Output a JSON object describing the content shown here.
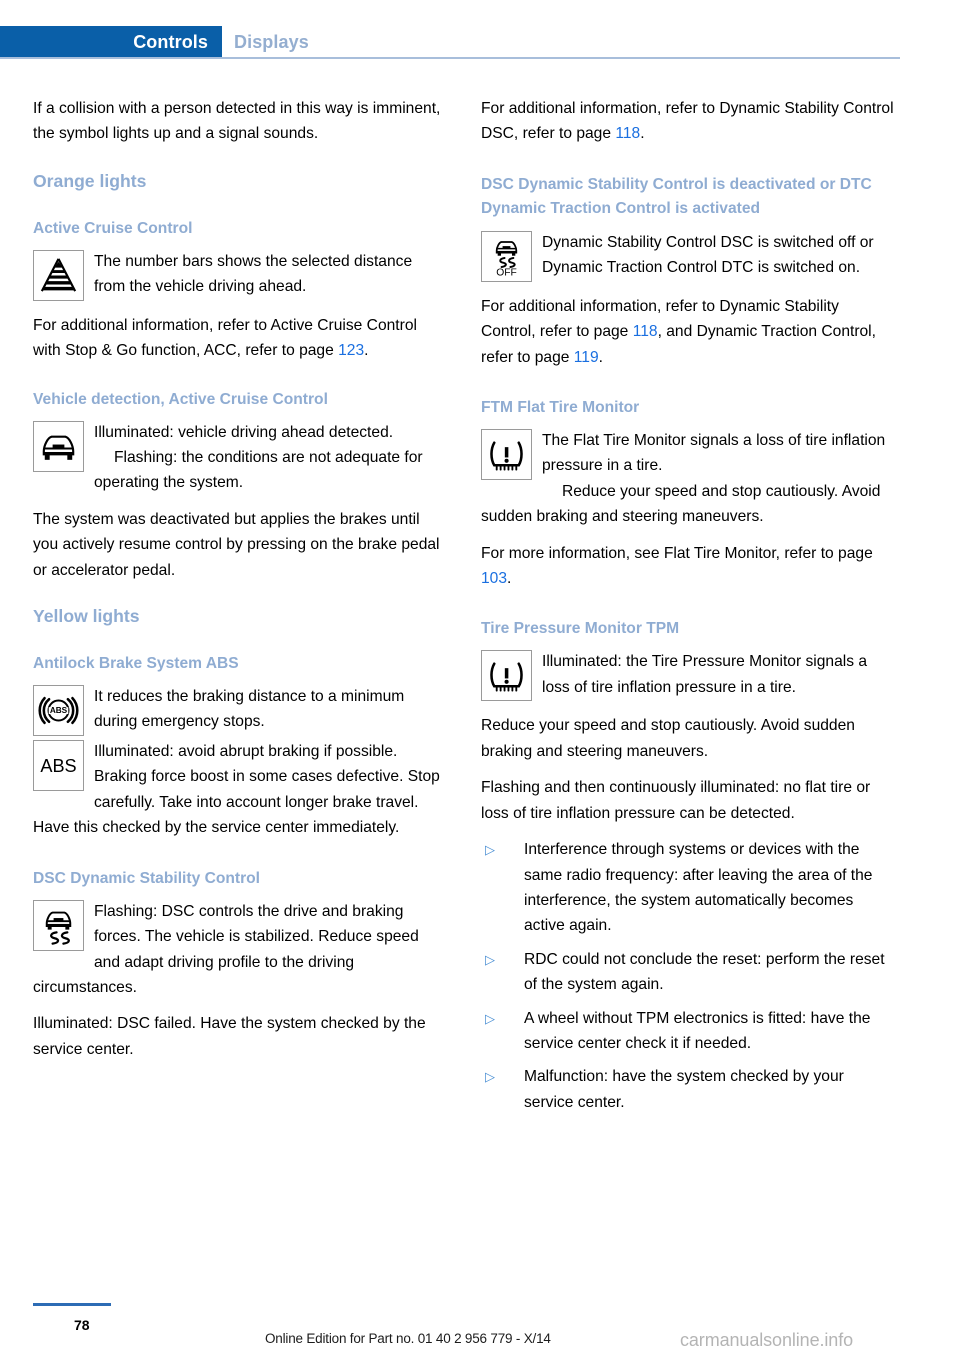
{
  "header": {
    "active_tab": "Controls",
    "inactive_tab": "Displays",
    "active_tab_color": "#0a5fa8",
    "inactive_tab_color": "#94aed0"
  },
  "colors": {
    "heading_blue": "#8facd2",
    "page_ref_blue": "#1a6fe0",
    "bullet_blue": "#4a8fd4"
  },
  "left_column": {
    "intro_paragraph": "If a collision with a person detected in this way is imminent, the symbol lights up and a signal sounds.",
    "section_orange": "Orange lights",
    "acc": {
      "heading": "Active Cruise Control",
      "icon_name": "distance-bars-icon",
      "icon_text": "The number bars shows the selected distance from the vehicle driving ahead.",
      "para_prefix": "For additional information, refer to Active Cruise Control with Stop & Go function, ACC, refer to page ",
      "page_ref": "123",
      "para_suffix": "."
    },
    "vehicle_detection": {
      "heading": "Vehicle detection, Active Cruise Control",
      "icon_name": "car-front-icon",
      "icon_text": "Illuminated: vehicle driving ahead detected.",
      "flashing_text": "Flashing: the conditions are not adequate for operating the system.",
      "system_text": "The system was deactivated but applies the brakes until you actively resume control by pressing on the brake pedal or accelerator pedal."
    },
    "section_yellow": "Yellow lights",
    "abs": {
      "heading": "Antilock Brake System ABS",
      "icon1_name": "abs-ring-icon",
      "icon1_text": "It reduces the braking distance to a minimum during emergency stops.",
      "icon2_name": "abs-text-icon",
      "icon2_label": "ABS",
      "icon2_text": "Illuminated: avoid abrupt braking if possible. Braking force boost in some cases defective. Stop carefully. Take into account longer brake travel. Have this checked by the service center immediately."
    },
    "dsc": {
      "heading": "DSC Dynamic Stability Control",
      "icon_name": "dsc-skid-icon",
      "icon_text": "Flashing: DSC controls the drive and braking forces. The vehicle is stabilized. Reduce speed and adapt driving profile to the driving circumstances.",
      "illuminated_text": "Illuminated: DSC failed. Have the system checked by the service center."
    }
  },
  "right_column": {
    "dsc_info": {
      "para_prefix": "For additional information, refer to Dynamic Stability Control DSC, refer to page ",
      "page_ref": "118",
      "para_suffix": "."
    },
    "dsc_off": {
      "heading": "DSC Dynamic Stability Control is deactivated or DTC Dynamic Traction Control is activated",
      "icon_name": "dsc-off-icon",
      "icon_label": "OFF",
      "icon_text": "Dynamic Stability Control DSC is switched off or Dynamic Traction Control DTC is switched on.",
      "para_part1": "For additional information, refer to Dynamic Stability Control, refer to page ",
      "page_ref_1": "118",
      "para_part2": ", and Dynamic Traction Control, refer to page ",
      "page_ref_2": "119",
      "para_part3": "."
    },
    "ftm": {
      "heading": "FTM Flat Tire Monitor",
      "icon_name": "tire-pressure-warning-icon",
      "icon_text": "The Flat Tire Monitor signals a loss of tire inflation pressure in a tire.",
      "reduce_text": "Reduce your speed and stop cautiously. Avoid sudden braking and steering maneuvers.",
      "more_info_prefix": "For more information, see Flat Tire Monitor, refer to page ",
      "page_ref": "103",
      "more_info_suffix": "."
    },
    "tpm": {
      "heading": "Tire Pressure Monitor TPM",
      "icon_name": "tire-pressure-warning-icon",
      "icon_text": "Illuminated: the Tire Pressure Monitor signals a loss of tire inflation pressure in a tire.",
      "reduce_text": "Reduce your speed and stop cautiously. Avoid sudden braking and steering maneuvers.",
      "flashing_text": "Flashing and then continuously illuminated: no flat tire or loss of tire inflation pressure can be detected.",
      "bullets": [
        "Interference through systems or devices with the same radio frequency: after leaving the area of the interference, the system automatically becomes active again.",
        "RDC could not conclude the reset: perform the reset of the system again.",
        "A wheel without TPM electronics is fitted: have the service center check it if needed.",
        "Malfunction: have the system checked by your service center."
      ]
    }
  },
  "footer": {
    "page_number": "78",
    "edition_text": "Online Edition for Part no. 01 40 2 956 779 - X/14",
    "watermark": "carmanualsonline.info"
  }
}
